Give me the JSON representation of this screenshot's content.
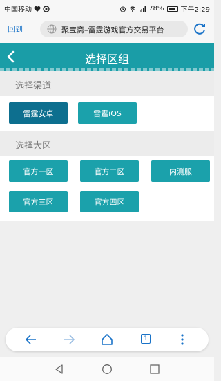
{
  "status_bar": {
    "carrier": "中国移动",
    "battery": "78%",
    "time": "下午2:29"
  },
  "address_bar": {
    "back_label": "回到",
    "url_title": "聚宝斋–雷霆游戏官方交易平台"
  },
  "header": {
    "title": "选择区组"
  },
  "channel_section": {
    "title": "选择渠道",
    "options": [
      {
        "label": "雷霆安卓",
        "selected": true
      },
      {
        "label": "雷霆iOS",
        "selected": false
      }
    ]
  },
  "region_section": {
    "title": "选择大区",
    "options": [
      {
        "label": "官方一区"
      },
      {
        "label": "官方二区"
      },
      {
        "label": "内测服"
      },
      {
        "label": "官方三区"
      },
      {
        "label": "官方四区"
      }
    ]
  },
  "toolbar": {
    "tab_count": "1"
  },
  "colors": {
    "primary": "#1a9da7",
    "button": "#1ba1ab",
    "selected": "#0d6f8f",
    "link": "#1a73c8"
  }
}
